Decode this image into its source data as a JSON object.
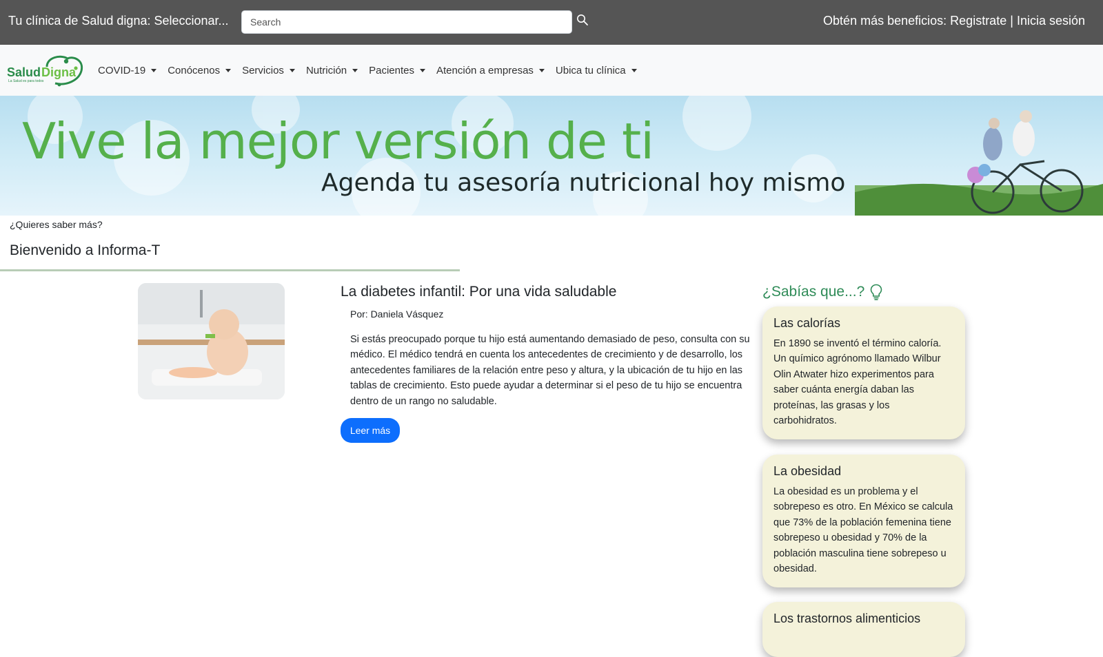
{
  "topbar": {
    "clinic_label": "Tu clínica de Salud digna: Seleccionar...",
    "search_placeholder": "Search",
    "auth_prefix": "Obtén más beneficios:",
    "register_label": "Registrate",
    "separator": "|",
    "login_label": "Inicia sesión",
    "background_color": "#555555"
  },
  "logo": {
    "brand_text": "SaludDigna",
    "tagline": "La Salud es para todos"
  },
  "nav": {
    "items": [
      {
        "label": "COVID-19"
      },
      {
        "label": "Conócenos"
      },
      {
        "label": "Servicios"
      },
      {
        "label": "Nutrición"
      },
      {
        "label": "Pacientes"
      },
      {
        "label": "Atención a empresas"
      },
      {
        "label": "Ubica tu clínica"
      }
    ]
  },
  "banner": {
    "title": "Vive la mejor versión de ti",
    "subtitle": "Agenda tu asesoría nutricional hoy mismo",
    "title_color": "#55b04b"
  },
  "intro": {
    "want_more": "¿Quieres saber más?",
    "welcome": "Bienvenido a Informa-T"
  },
  "article": {
    "title": "La diabetes infantil: Por una vida saludable",
    "author": "Por: Daniela Vásquez",
    "body": "Si estás preocupado porque tu hijo está aumentando demasiado de peso, consulta con su médico. El médico tendrá en cuenta los antecedentes de crecimiento y de desarrollo, los antecedentes familiares de la relación entre peso y altura, y la ubicación de tu hijo en las tablas de crecimiento. Esto puede ayudar a determinar si el peso de tu hijo se encuentra dentro de un rango no saludable.",
    "read_more": "Leer más",
    "button_color": "#0d6efd"
  },
  "did_you_know": {
    "heading": "¿Sabías que...?",
    "heading_color": "#2e8b57",
    "cards": [
      {
        "title": "Las calorías",
        "text": "En 1890 se inventó el término caloría. Un químico agrónomo llamado Wilbur Olin Atwater hizo experimentos para saber cuánta energía daban las proteínas, las grasas y los carbohidratos."
      },
      {
        "title": "La obesidad",
        "text": "La obesidad es un problema y el sobrepeso es otro. En México se calcula que 73% de la población femenina tiene sobrepeso u obesidad y 70% de la población masculina tiene sobrepeso u obesidad."
      },
      {
        "title": "Los trastornos alimenticios",
        "text": ""
      }
    ],
    "card_color": "#f4f2da"
  }
}
